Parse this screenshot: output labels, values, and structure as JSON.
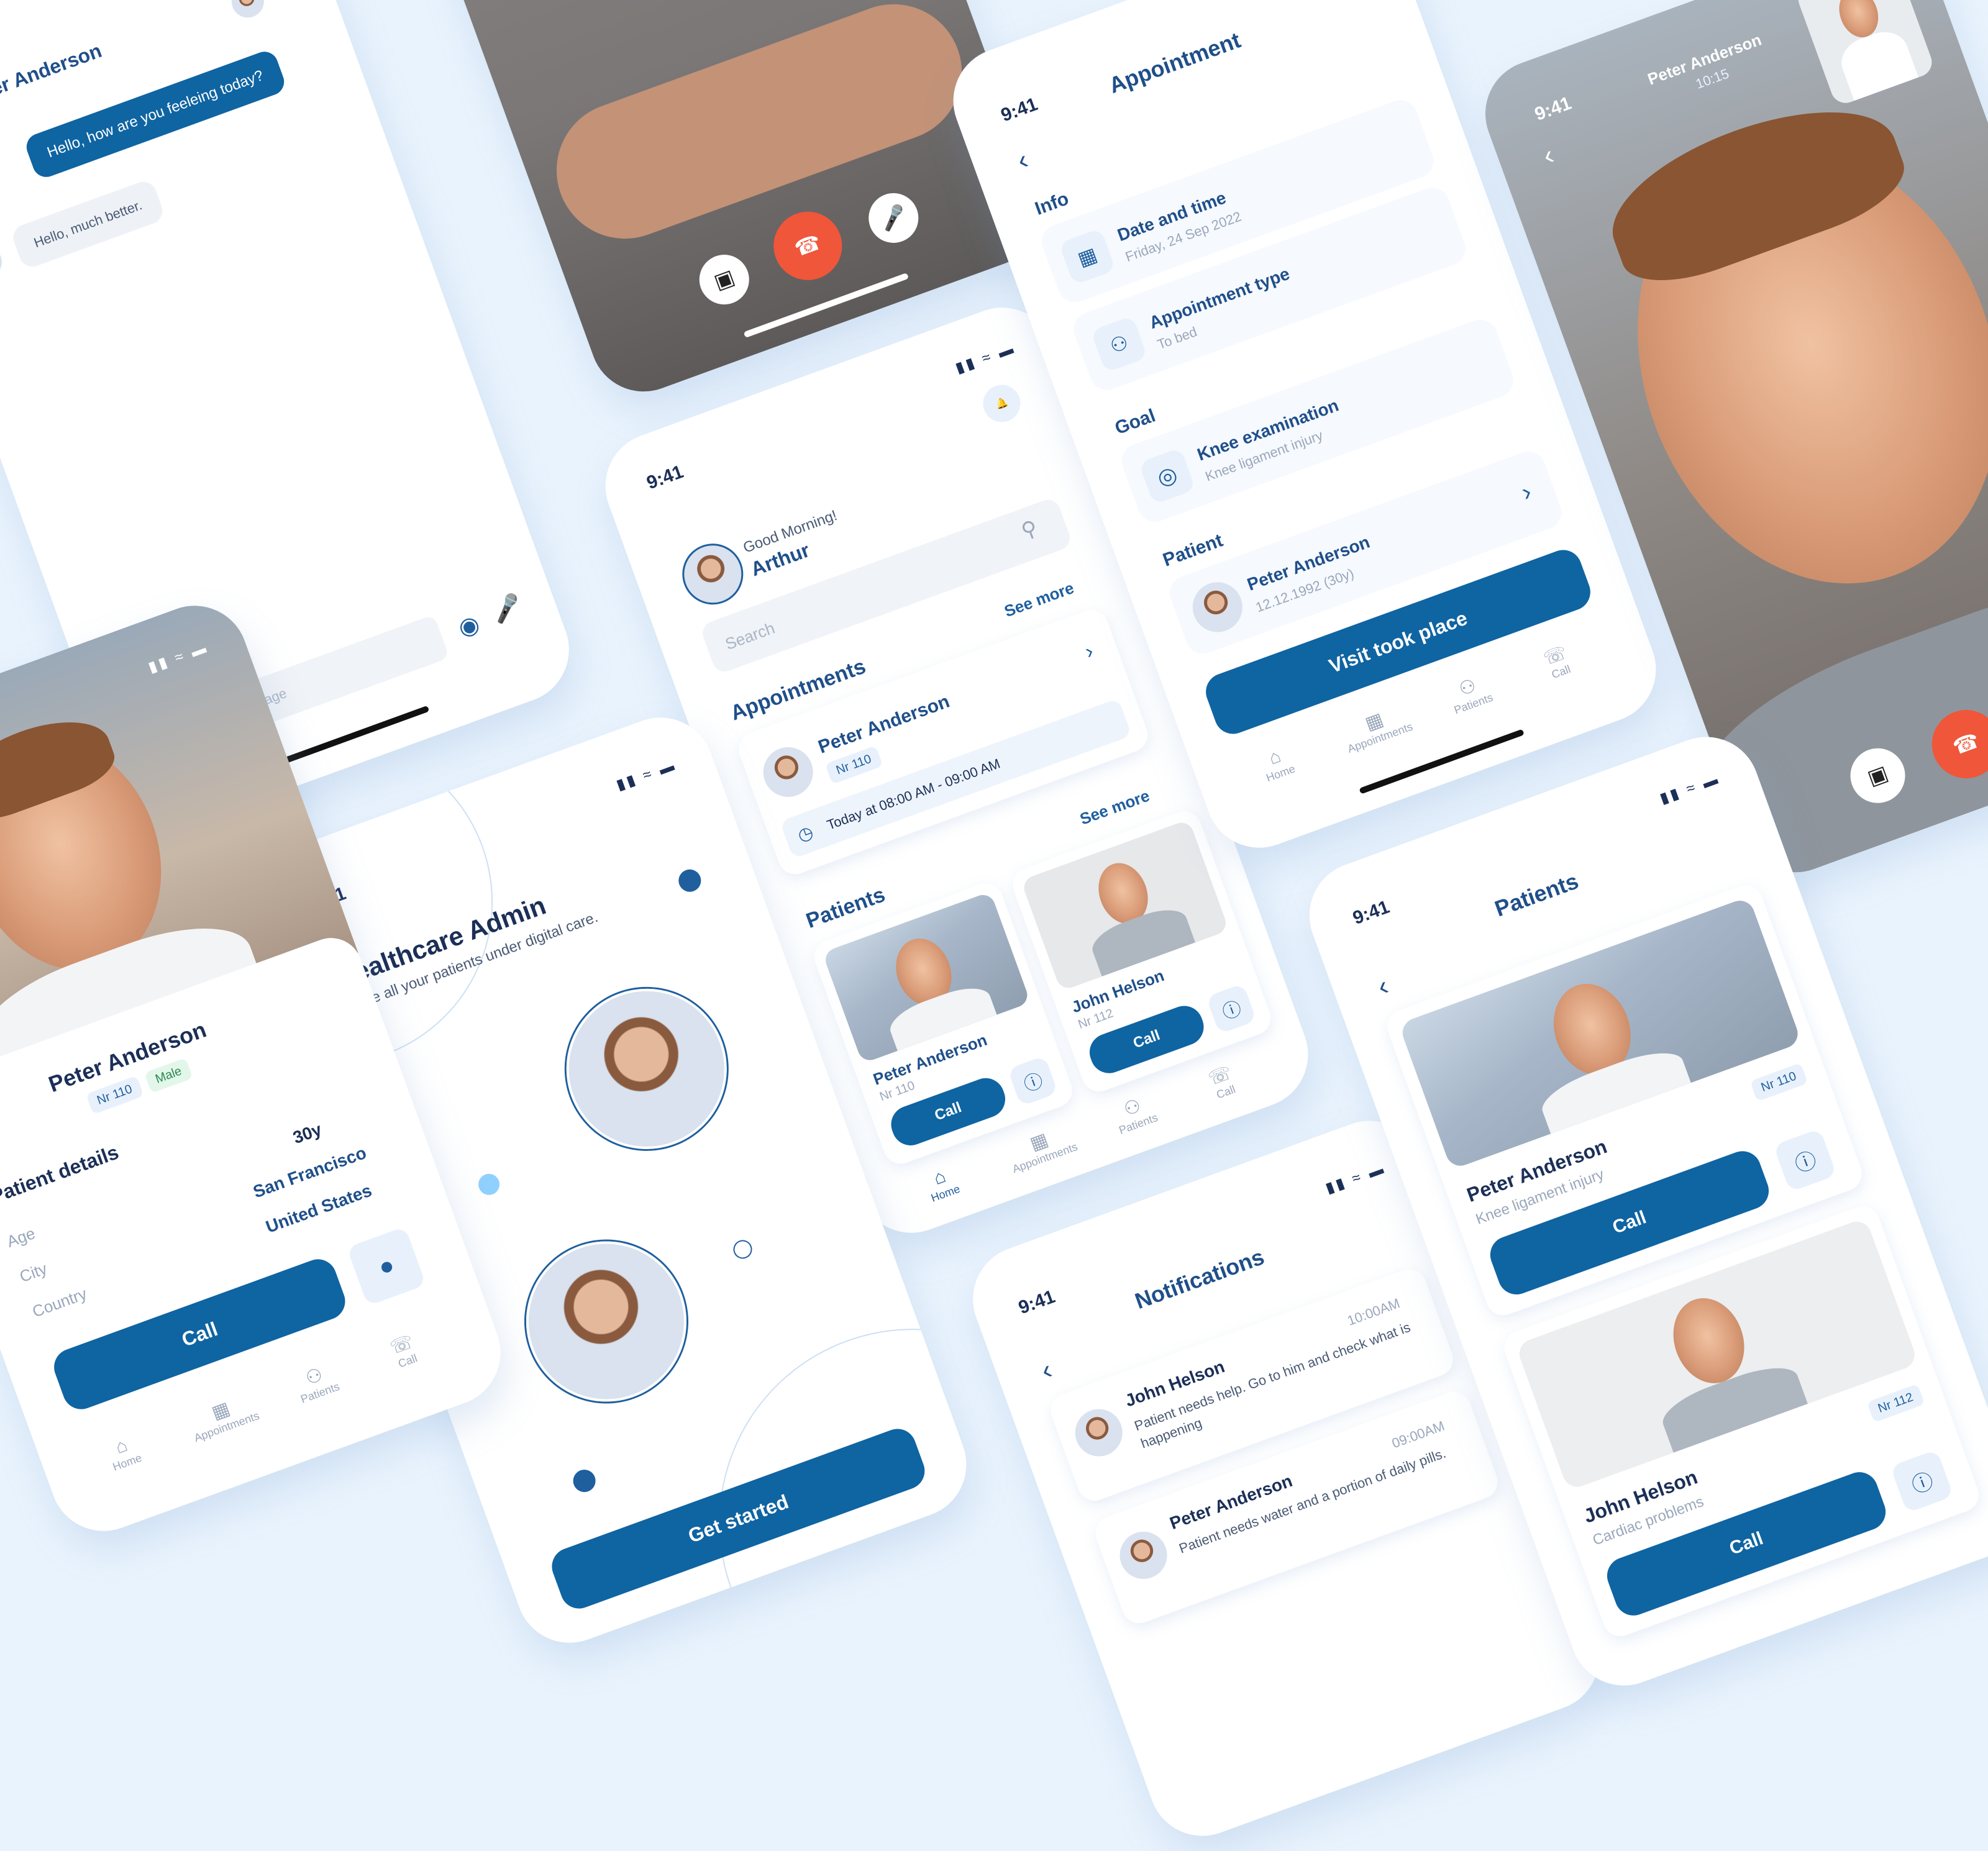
{
  "status": {
    "time": "9:41"
  },
  "chat": {
    "contact": "Peter Anderson",
    "msg_out": "Hello, how are you feeleing today?",
    "msg_in": "Hello, much better.",
    "input_placeholder": "New message"
  },
  "home": {
    "greeting": "Good Morning!",
    "user": "Arthur",
    "search_placeholder": "Search",
    "see_more": "See more",
    "appointments_title": "Appointments",
    "appt_name": "Peter Anderson",
    "appt_nr": "Nr 110",
    "appt_time": "Today at 08:00 AM - 09:00 AM",
    "patients_title": "Patients",
    "patient1_name": "Peter Anderson",
    "patient1_nr": "Nr 110",
    "patient2_name": "John Helson",
    "patient2_nr": "Nr 112",
    "call": "Call",
    "nav": [
      "Home",
      "Appointments",
      "Patients",
      "Call"
    ]
  },
  "appointment": {
    "title": "Appointment",
    "info_label": "Info",
    "date_title": "Date and time",
    "date_value": "Friday, 24 Sep 2022",
    "type_title": "Appointment type",
    "type_value": "To bed",
    "goal_label": "Goal",
    "goal_title": "Knee examination",
    "goal_value": "Knee ligament injury",
    "patient_label": "Patient",
    "patient_name": "Peter Anderson",
    "patient_dob": "12.12.1992 (30y)",
    "visit_btn": "Visit took place",
    "nav": [
      "Home",
      "Appointments",
      "Patients",
      "Call"
    ]
  },
  "videocall": {
    "name": "Peter Anderson",
    "duration": "10:15"
  },
  "welcome": {
    "title": "Healthcare Admin",
    "subtitle": "Have all your patients under digital care.",
    "cta": "Get started"
  },
  "profile": {
    "name": "Peter Anderson",
    "nr": "Nr 110",
    "gender": "Male",
    "details_title": "Patient details",
    "age_label": "Age",
    "age_value": "30y",
    "city_label": "City",
    "city_value": "San Francisco",
    "country_label": "Country",
    "country_value": "United States",
    "call": "Call",
    "nav": [
      "Home",
      "Appointments",
      "Patients",
      "Call"
    ]
  },
  "patients_list": {
    "title": "Patients",
    "p1_name": "Peter Anderson",
    "p1_desc": "Knee ligament injury",
    "p1_nr": "Nr 110",
    "p2_name": "John Helson",
    "p2_desc": "Cardiac problems",
    "p2_nr": "Nr 112",
    "call": "Call"
  },
  "notifications": {
    "title": "Notifications",
    "n1_name": "John Helson",
    "n1_time": "10:00AM",
    "n1_text": "Patient needs help. Go to him and check what is happening",
    "n2_name": "Peter Anderson",
    "n2_time": "09:00AM",
    "n2_text": "Patient needs water and a portion of daily pills."
  },
  "colors": {
    "primary": "#0f64a2",
    "text": "#1b2f57",
    "bg": "#e9f3fd",
    "end_call": "#f0563a"
  }
}
